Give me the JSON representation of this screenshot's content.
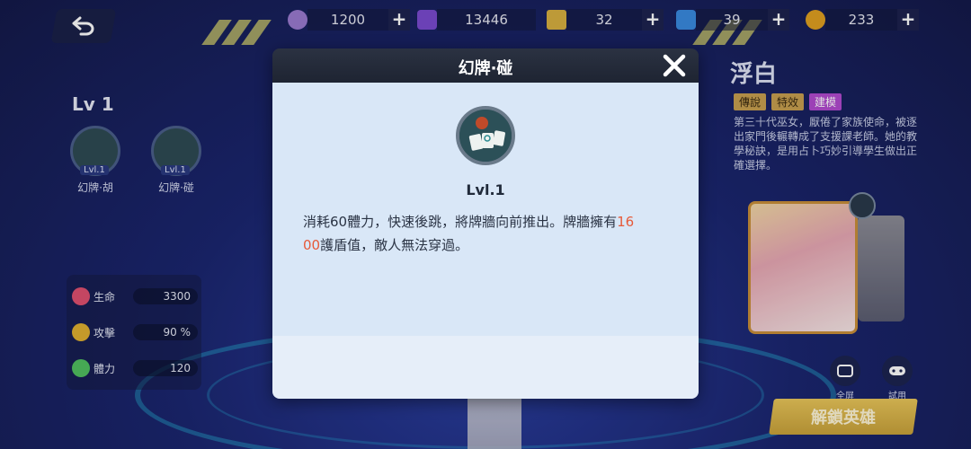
{
  "topbar": {
    "resources": [
      {
        "icon": "purple-orb-icon",
        "value": "1200",
        "color": "#9a7ad0"
      },
      {
        "icon": "purple-gem-icon",
        "value": "13446",
        "color": "#7a4ad0"
      },
      {
        "icon": "gold-card-icon",
        "value": "32",
        "color": "#d8b040"
      },
      {
        "icon": "blue-crystal-icon",
        "value": "39",
        "color": "#3a8ae0"
      },
      {
        "icon": "gold-coin-icon",
        "value": "233",
        "color": "#e0a020"
      }
    ],
    "plus_label": "+"
  },
  "left_panel": {
    "level": "Lv 1",
    "skills": [
      {
        "tag": "Lvl.1",
        "name": "幻牌·胡"
      },
      {
        "tag": "Lvl.1",
        "name": "幻牌·碰"
      }
    ],
    "stats": [
      {
        "icon": "heart-icon",
        "label": "生命",
        "value": "3300",
        "color": "#e05070"
      },
      {
        "icon": "attack-icon",
        "label": "攻擊",
        "value": "90 %",
        "color": "#e0b030"
      },
      {
        "icon": "lightning-icon",
        "label": "體力",
        "value": "120",
        "color": "#50c060"
      }
    ]
  },
  "right_panel": {
    "hero_name": "浮白",
    "tags": [
      {
        "label": "傳說",
        "bg": "#c8a050",
        "color": "#3a2a10"
      },
      {
        "label": "特效",
        "bg": "#c8a050",
        "color": "#3a2a10"
      },
      {
        "label": "建模",
        "bg": "#b24ad0",
        "color": "#ffffff"
      }
    ],
    "description": "第三十代巫女，厭倦了家族使命，被逐出家門後輾轉成了支援課老師。她的教學秘訣，是用占卜巧妙引導學生做出正確選擇。",
    "tools": [
      {
        "icon": "fullscreen-icon",
        "label": "全屏"
      },
      {
        "icon": "gamepad-icon",
        "label": "試用"
      }
    ],
    "unlock_label": "解鎖英雄"
  },
  "modal": {
    "title": "幻牌·碰",
    "level": "Lvl.1",
    "desc_part1": "消耗60體力，快速後跳，將牌牆向前推出。牌牆擁有",
    "desc_highlight1": "16",
    "desc_highlight2": "00",
    "desc_part2": "護盾值，敵人無法穿過。"
  }
}
